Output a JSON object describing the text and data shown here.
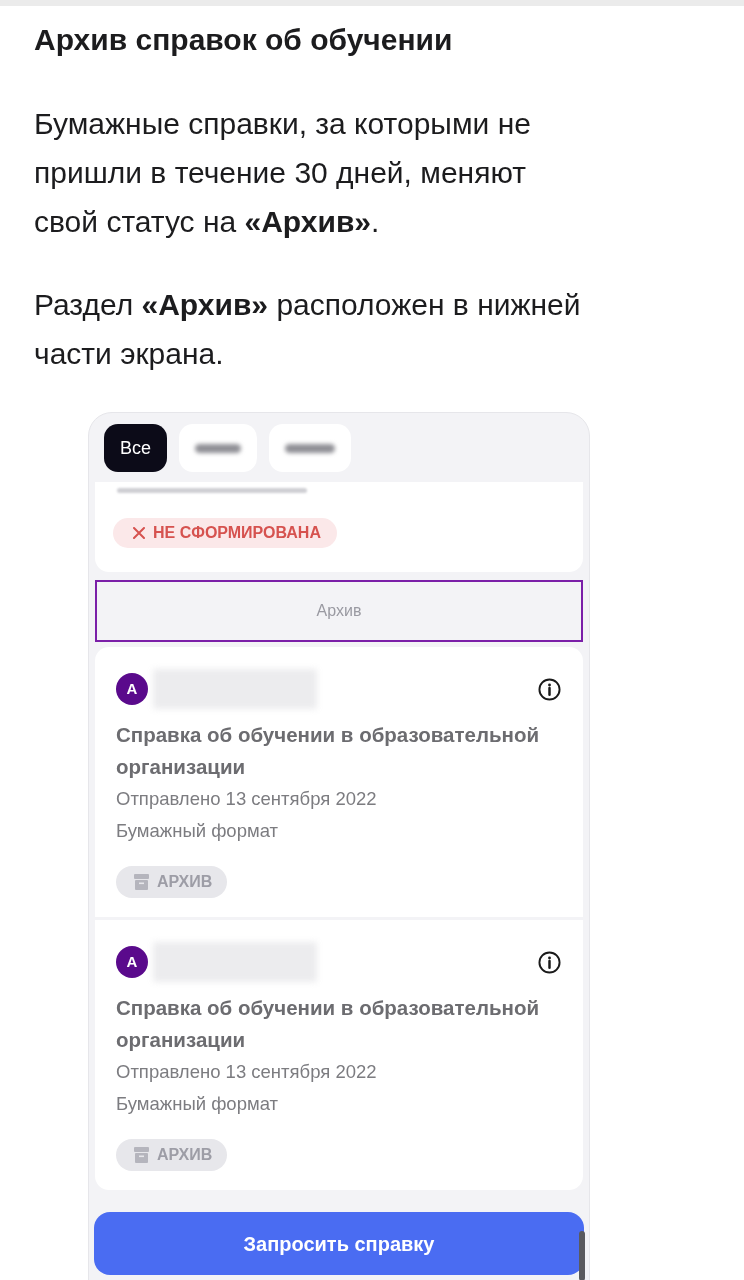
{
  "article": {
    "title": "Архив справок об обучении",
    "paragraphs": [
      "Бумажные справки, за которыми не пришли в течение 30 дней, меняют свой статус на **«Архив»**.",
      "Раздел **«Архив»** расположен в нижней части экрана."
    ]
  },
  "screenshot": {
    "tabs": [
      {
        "label": "Все",
        "selected": true
      },
      {
        "selected": false
      },
      {
        "selected": false
      }
    ],
    "status_badge": "НЕ СФОРМИРОВАНА",
    "section": {
      "label": "Архив",
      "highlighted": true
    },
    "cards": [
      {
        "avatar": "А",
        "title": "Справка об обучении в образовательной организации",
        "sent": "Отправлено 13 сентября 2022",
        "format": "Бумажный формат",
        "status": "АРХИВ"
      },
      {
        "avatar": "А",
        "title": "Справка об обучении в образовательной организации",
        "sent": "Отправлено 13 сентября 2022",
        "format": "Бумажный формат",
        "status": "АРХИВ"
      }
    ],
    "button": "Запросить справку"
  }
}
